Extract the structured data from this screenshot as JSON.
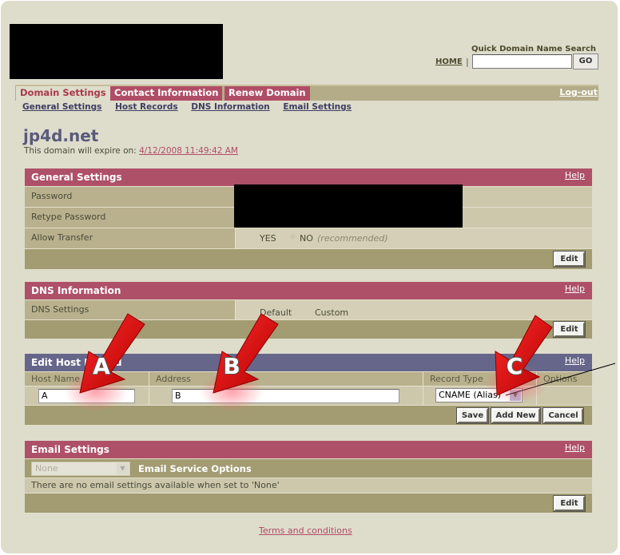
{
  "header": {
    "logo_redacted": true,
    "quick_search": {
      "title": "Quick Domain Name Search",
      "home_label": "HOME",
      "separator": "|",
      "input_value": "",
      "go_label": "GO"
    }
  },
  "nav": {
    "tabs": [
      {
        "label": "Domain Settings",
        "active": true
      },
      {
        "label": "Contact Information",
        "active": false
      },
      {
        "label": "Renew Domain",
        "active": false
      }
    ],
    "logout_label": "Log-out",
    "subnav": [
      "General Settings",
      "Host Records",
      "DNS Information",
      "Email Settings"
    ]
  },
  "domain": {
    "name": "jp4d.net",
    "expire_prefix": "This domain will expire on:",
    "expire_date": "4/12/2008 11:49:42 AM"
  },
  "general_settings": {
    "title": "General Settings",
    "help_label": "Help",
    "rows": [
      {
        "label": "Password",
        "value": "[redacted]"
      },
      {
        "label": "Retype Password",
        "value": "[redacted]"
      },
      {
        "label": "Allow Transfer",
        "options": [
          "YES",
          "NO"
        ],
        "selected": "NO",
        "note": "(recommended)"
      }
    ],
    "edit_label": "Edit"
  },
  "dns_information": {
    "title": "DNS Information",
    "help_label": "Help",
    "row_label": "DNS Settings",
    "options": [
      "Default",
      "Custom"
    ],
    "edit_label": "Edit"
  },
  "edit_host_record": {
    "title": "Edit Host Record",
    "help_label": "Help",
    "columns": [
      "Host Name",
      "Address",
      "Record Type",
      "Options"
    ],
    "host_name_value": "A",
    "address_value": "B",
    "record_type_value": "CNAME (Alias)",
    "buttons": {
      "save": "Save",
      "add_new": "Add New",
      "cancel": "Cancel"
    }
  },
  "email_settings": {
    "title": "Email Settings",
    "help_label": "Help",
    "service_select_value": "None",
    "service_label": "Email Service Options",
    "message": "There are no email settings available when set to 'None'",
    "edit_label": "Edit"
  },
  "footer": {
    "terms_label": "Terms and conditions"
  },
  "annotations": {
    "arrow_labels": [
      "A",
      "B",
      "C"
    ],
    "arrow_color": "#d40000"
  }
}
